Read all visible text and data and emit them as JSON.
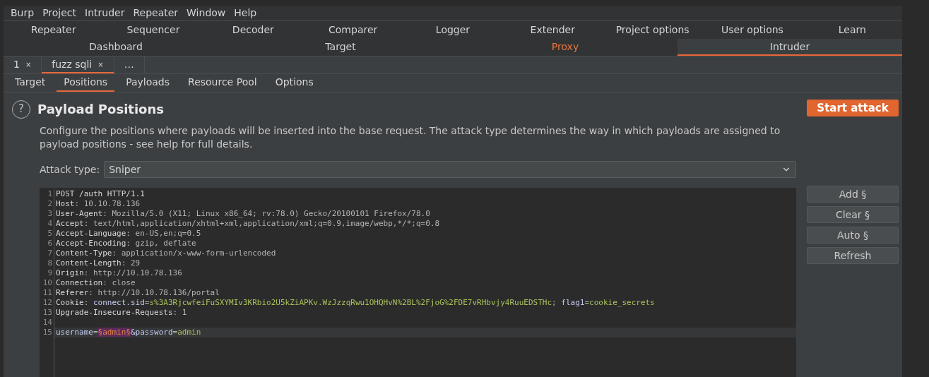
{
  "menu": [
    "Burp",
    "Project",
    "Intruder",
    "Repeater",
    "Window",
    "Help"
  ],
  "tool_tabs_row1": [
    {
      "label": "Repeater"
    },
    {
      "label": "Sequencer"
    },
    {
      "label": "Decoder"
    },
    {
      "label": "Comparer"
    },
    {
      "label": "Logger"
    },
    {
      "label": "Extender"
    },
    {
      "label": "Project options"
    },
    {
      "label": "User options"
    },
    {
      "label": "Learn"
    }
  ],
  "tool_tabs_row2": [
    {
      "label": "Dashboard",
      "selected": false,
      "highlighted": false
    },
    {
      "label": "Target",
      "selected": false,
      "highlighted": false
    },
    {
      "label": "Proxy",
      "selected": false,
      "highlighted": true
    },
    {
      "label": "Intruder",
      "selected": true,
      "highlighted": false
    }
  ],
  "attack_tabs": [
    {
      "label": "1",
      "close": "×",
      "selected": false
    },
    {
      "label": "fuzz sqli",
      "close": "×",
      "selected": true
    },
    {
      "label": "…",
      "selected": false
    }
  ],
  "sub_tabs": [
    {
      "label": "Target",
      "selected": false
    },
    {
      "label": "Positions",
      "selected": true
    },
    {
      "label": "Payloads",
      "selected": false
    },
    {
      "label": "Resource Pool",
      "selected": false
    },
    {
      "label": "Options",
      "selected": false
    }
  ],
  "section": {
    "help_icon": "?",
    "title": "Payload Positions",
    "description": "Configure the positions where payloads will be inserted into the base request. The attack type determines the way in which payloads are assigned to payload positions - see help for full details.",
    "start_button": "Start attack"
  },
  "attack_type": {
    "label": "Attack type:",
    "value": "Sniper"
  },
  "request_lines": [
    {
      "number": "1",
      "current": false,
      "segments": [
        {
          "text": "POST /auth HTTP/1.1",
          "kind": "name"
        }
      ]
    },
    {
      "number": "2",
      "current": false,
      "segments": [
        {
          "text": "Host",
          "kind": "name"
        },
        {
          "text": ": 10.10.78.136",
          "kind": "plain"
        }
      ]
    },
    {
      "number": "3",
      "current": false,
      "segments": [
        {
          "text": "User-Agent",
          "kind": "name"
        },
        {
          "text": ": Mozilla/5.0 (X11; Linux x86_64; rv:78.0) Gecko/20100101 Firefox/78.0",
          "kind": "plain"
        }
      ]
    },
    {
      "number": "4",
      "current": false,
      "segments": [
        {
          "text": "Accept",
          "kind": "name"
        },
        {
          "text": ": text/html,application/xhtml+xml,application/xml;q=0.9,image/webp,*/*;q=0.8",
          "kind": "plain"
        }
      ]
    },
    {
      "number": "5",
      "current": false,
      "segments": [
        {
          "text": "Accept-Language",
          "kind": "name"
        },
        {
          "text": ": en-US,en;q=0.5",
          "kind": "plain"
        }
      ]
    },
    {
      "number": "6",
      "current": false,
      "segments": [
        {
          "text": "Accept-Encoding",
          "kind": "name"
        },
        {
          "text": ": gzip, deflate",
          "kind": "plain"
        }
      ]
    },
    {
      "number": "7",
      "current": false,
      "segments": [
        {
          "text": "Content-Type",
          "kind": "name"
        },
        {
          "text": ": application/x-www-form-urlencoded",
          "kind": "plain"
        }
      ]
    },
    {
      "number": "8",
      "current": false,
      "segments": [
        {
          "text": "Content-Length",
          "kind": "name"
        },
        {
          "text": ": 29",
          "kind": "plain"
        }
      ]
    },
    {
      "number": "9",
      "current": false,
      "segments": [
        {
          "text": "Origin",
          "kind": "name"
        },
        {
          "text": ": http://10.10.78.136",
          "kind": "plain"
        }
      ]
    },
    {
      "number": "10",
      "current": false,
      "segments": [
        {
          "text": "Connection",
          "kind": "name"
        },
        {
          "text": ": close",
          "kind": "plain"
        }
      ]
    },
    {
      "number": "11",
      "current": false,
      "segments": [
        {
          "text": "Referer",
          "kind": "name"
        },
        {
          "text": ": http://10.10.78.136/portal",
          "kind": "plain"
        }
      ]
    },
    {
      "number": "12",
      "current": false,
      "segments": [
        {
          "text": "Cookie",
          "kind": "name"
        },
        {
          "text": ": ",
          "kind": "plain"
        },
        {
          "text": "connect.sid",
          "kind": "param"
        },
        {
          "text": "=",
          "kind": "plain"
        },
        {
          "text": "s%3A3RjcwfeiFuSXYMIv3KRbio2U5kZiAPKv.WzJzzqRwu1OHQHvN%2BL%2FjoG%2FDE7vRHbvjy4RuuEDSTHc",
          "kind": "value"
        },
        {
          "text": "; ",
          "kind": "plain"
        },
        {
          "text": "flag1",
          "kind": "param"
        },
        {
          "text": "=",
          "kind": "plain"
        },
        {
          "text": "cookie_secrets",
          "kind": "value"
        }
      ]
    },
    {
      "number": "13",
      "current": false,
      "segments": [
        {
          "text": "Upgrade-Insecure-Requests",
          "kind": "name"
        },
        {
          "text": ": 1",
          "kind": "plain"
        }
      ]
    },
    {
      "number": "14",
      "current": false
    },
    {
      "number": "15",
      "current": true,
      "segments": [
        {
          "text": "username",
          "kind": "param"
        },
        {
          "text": "=",
          "kind": "plain"
        },
        {
          "text": "§admin§",
          "kind": "marker"
        },
        {
          "text": "&password",
          "kind": "param"
        },
        {
          "text": "=",
          "kind": "plain"
        },
        {
          "text": "admin",
          "kind": "value"
        }
      ]
    }
  ],
  "side_buttons": [
    "Add §",
    "Clear §",
    "Auto §",
    "Refresh"
  ]
}
